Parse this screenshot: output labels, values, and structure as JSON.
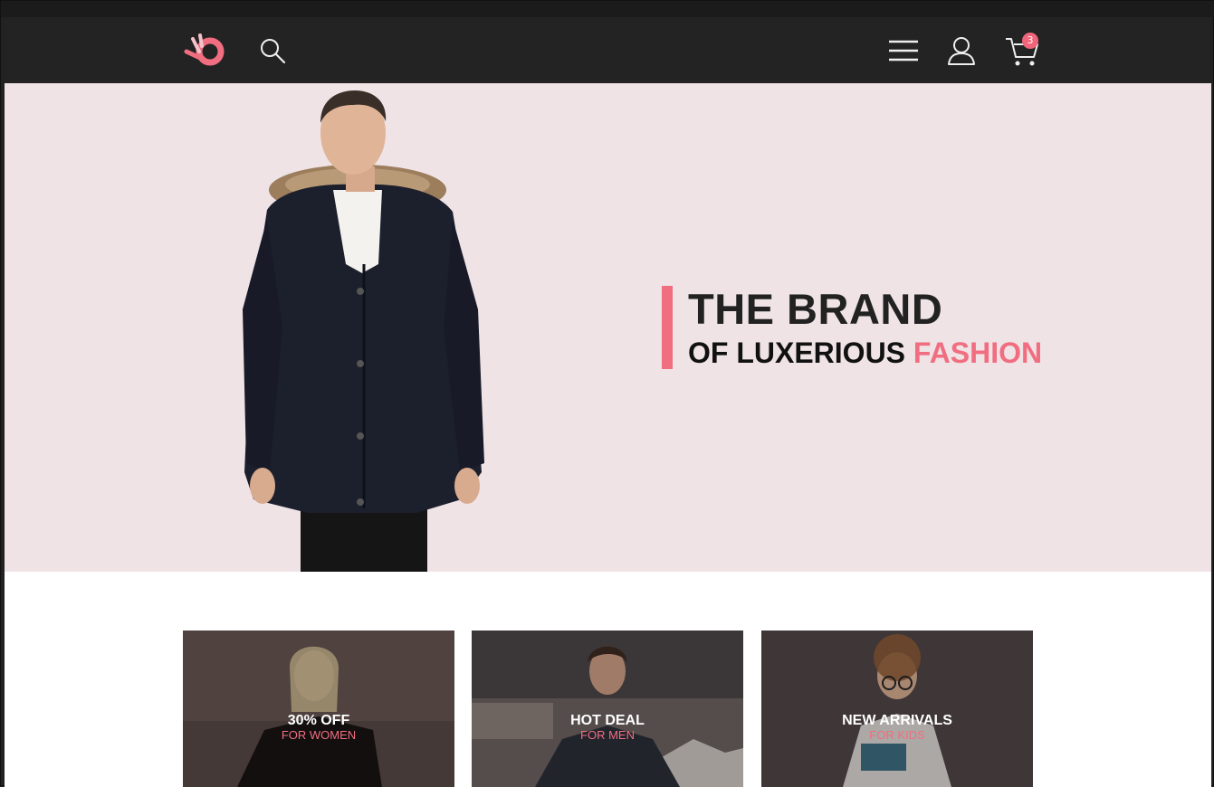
{
  "header": {
    "logo_name": "logo-icon",
    "cart_count": "3",
    "colors": {
      "bar": "#232323",
      "accent": "#f06e80"
    }
  },
  "hero": {
    "title": "THE BRAND",
    "subtitle_prefix": "OF LUXERIOUS",
    "subtitle_highlight": "FASHION",
    "background": "#efe3e6"
  },
  "promos": [
    {
      "title": "30% OFF",
      "subtitle": "FOR WOMEN"
    },
    {
      "title": "HOT DEAL",
      "subtitle": "FOR MEN"
    },
    {
      "title": "NEW ARRIVALS",
      "subtitle": "FOR KIDS"
    }
  ]
}
